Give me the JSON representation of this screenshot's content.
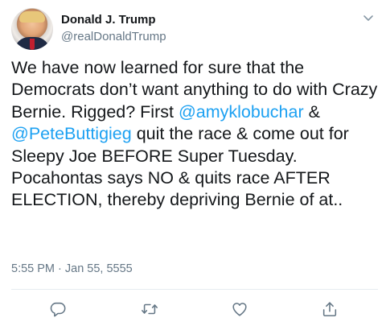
{
  "user": {
    "display_name": "Donald J. Trump",
    "handle": "@realDonaldTrump"
  },
  "tweet": {
    "segments": [
      {
        "text": "We have now learned for sure that the Democrats don’t want anything to do with Crazy Bernie. Rigged? First ",
        "type": "text"
      },
      {
        "text": "@amyklobuchar",
        "type": "mention"
      },
      {
        "text": " & ",
        "type": "text"
      },
      {
        "text": "@PeteButtigieg",
        "type": "mention"
      },
      {
        "text": " quit the race & come out for Sleepy Joe BEFORE Super Tuesday. Pocahontas says NO & quits race AFTER ELECTION, thereby depriving Bernie of at..",
        "type": "text"
      }
    ],
    "timestamp": "5:55 PM · Jan 55, 5555"
  },
  "actions": [
    {
      "name": "reply",
      "icon": "reply-icon"
    },
    {
      "name": "retweet",
      "icon": "retweet-icon"
    },
    {
      "name": "like",
      "icon": "heart-icon"
    },
    {
      "name": "share",
      "icon": "share-icon"
    }
  ],
  "colors": {
    "mention": "#1da1f2",
    "secondary_text": "#657786",
    "primary_text": "#14171a"
  }
}
